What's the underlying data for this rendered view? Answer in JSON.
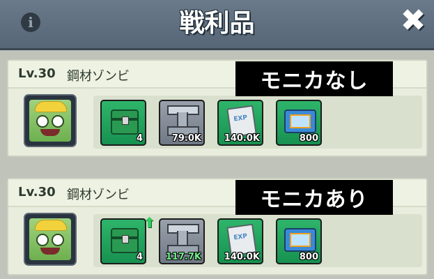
{
  "header": {
    "title": "戦利品",
    "info_icon": "i",
    "close_icon": "✖"
  },
  "panels": [
    {
      "level": "Lv.30",
      "name": "鋼材ゾンビ",
      "ribbon": "モニカなし",
      "items": [
        {
          "icon": "chest-icon",
          "qty": "4"
        },
        {
          "icon": "steel-beam-icon",
          "qty": "79.0K"
        },
        {
          "icon": "exp-book-icon",
          "qty": "140.0K"
        },
        {
          "icon": "ticket-icon",
          "qty": "800"
        }
      ]
    },
    {
      "level": "Lv.30",
      "name": "鋼材ゾンビ",
      "ribbon": "モニカあり",
      "items": [
        {
          "icon": "chest-icon",
          "qty": "4"
        },
        {
          "icon": "steel-beam-icon",
          "qty": "117.7K",
          "boosted": true
        },
        {
          "icon": "exp-book-icon",
          "qty": "140.0K"
        },
        {
          "icon": "ticket-icon",
          "qty": "800"
        }
      ]
    }
  ],
  "colors": {
    "header": "#5f6f7f",
    "panel": "#e9edde",
    "item_green": "#1ea35c",
    "boost": "#6ef08a"
  }
}
